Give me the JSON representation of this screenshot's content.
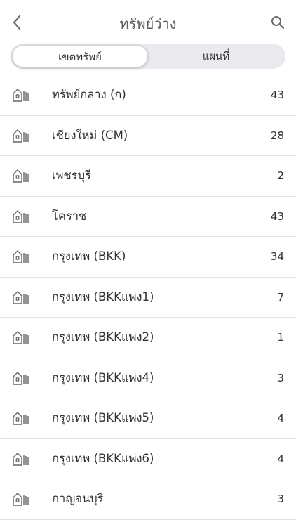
{
  "header": {
    "title": "ทรัพย์ว่าง",
    "back_icon": "chevron-left-icon",
    "search_icon": "search-icon"
  },
  "segment": {
    "tabs": [
      {
        "label": "เขตทรัพย์",
        "active": true
      },
      {
        "label": "แผนที่",
        "active": false
      }
    ]
  },
  "branches": [
    {
      "name": "ทรัพย์กลาง (ก)",
      "count": "43"
    },
    {
      "name": "เชียงใหม่ (CM)",
      "count": "28"
    },
    {
      "name": "เพชรบุรี",
      "count": "2"
    },
    {
      "name": "โคราช",
      "count": "43"
    },
    {
      "name": "กรุงเทพ (BKK)",
      "count": "34"
    },
    {
      "name": "กรุงเทพ (BKKแพ่ง1)",
      "count": "7"
    },
    {
      "name": "กรุงเทพ (BKKแพ่ง2)",
      "count": "1"
    },
    {
      "name": "กรุงเทพ (BKKแพ่ง4)",
      "count": "3"
    },
    {
      "name": "กรุงเทพ (BKKแพ่ง5)",
      "count": "4"
    },
    {
      "name": "กรุงเทพ (BKKแพ่ง6)",
      "count": "4"
    },
    {
      "name": "กาญจนบุรี",
      "count": "3"
    }
  ],
  "colors": {
    "text": "#333333",
    "title": "#5c5c5c",
    "segment_bg": "#e9e9ee",
    "divider": "#e3e3e3"
  }
}
